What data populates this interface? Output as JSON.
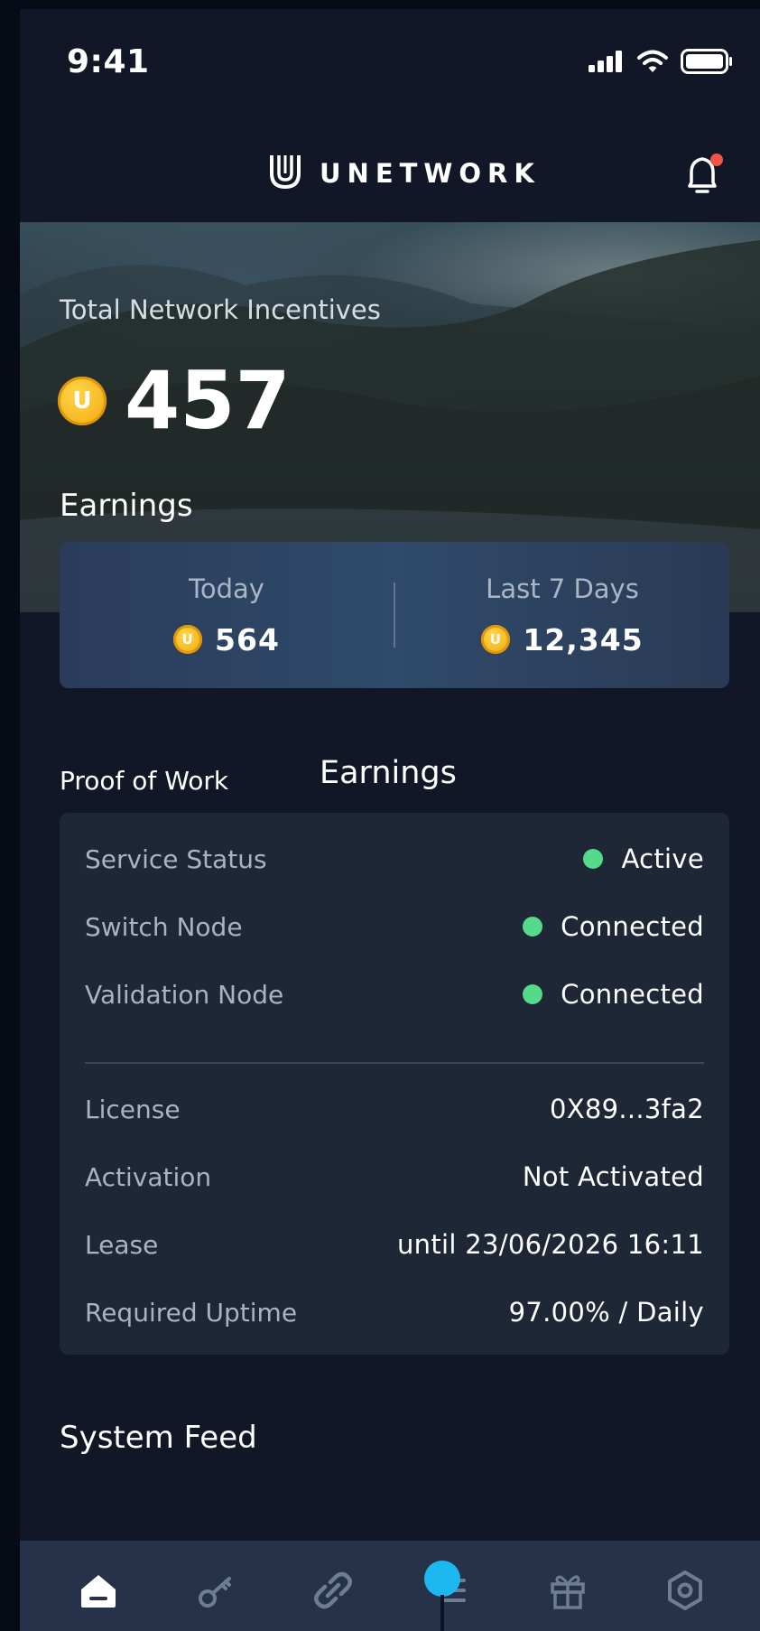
{
  "status_bar": {
    "time": "9:41"
  },
  "header": {
    "brand": "UNETWORK",
    "logo_letter": "U",
    "notification_dot_color": "#f05545"
  },
  "hero": {
    "incentives_label": "Total Network Incentives",
    "total_value": "457",
    "coin_symbol": "U"
  },
  "earnings": {
    "title": "Earnings",
    "today": {
      "label": "Today",
      "value": "564"
    },
    "last7": {
      "label": "Last 7 Days",
      "value": "12,345"
    }
  },
  "proof_of_work": {
    "label": "Proof of Work",
    "earnings_label": "Earnings"
  },
  "status": {
    "service_status": {
      "label": "Service Status",
      "value": "Active"
    },
    "switch_node": {
      "label": "Switch Node",
      "value": "Connected"
    },
    "validation_node": {
      "label": "Validation Node",
      "value": "Connected"
    },
    "license": {
      "label": "License",
      "value": "0X89...3fa2"
    },
    "activation": {
      "label": "Activation",
      "value": "Not Activated"
    },
    "lease": {
      "label": "Lease",
      "value": "until 23/06/2026 16:11"
    },
    "required_uptime": {
      "label": "Required Uptime",
      "value": "97.00% / Daily"
    }
  },
  "feed": {
    "title": "System Feed"
  },
  "nav": {
    "items": [
      "home-icon",
      "key-icon",
      "link-icon",
      "list-icon",
      "gift-icon",
      "settings-hex-icon"
    ],
    "active_index": 0,
    "active_color": "#ffffff",
    "inactive_color": "#6f7d93",
    "indicator_color": "#1eb8f0"
  },
  "colors": {
    "background": "#111726",
    "card": "#1e2736",
    "status_green": "#55d98a",
    "coin_gold": "#f5b81b"
  }
}
